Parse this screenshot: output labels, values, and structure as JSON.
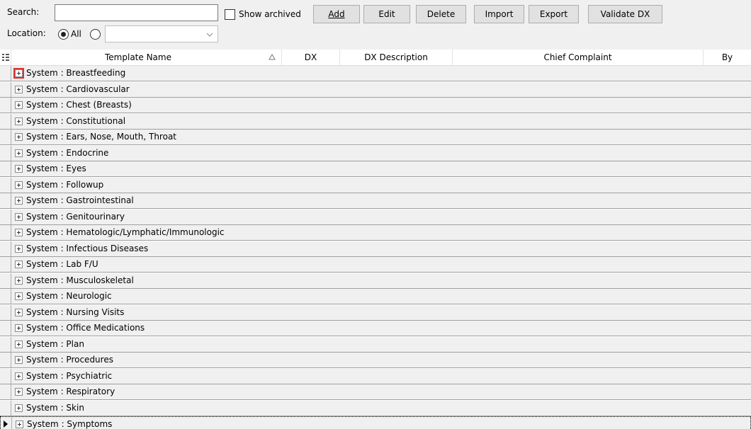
{
  "toolbar": {
    "search_label": "Search:",
    "search_value": "",
    "show_archived_label": "Show archived",
    "buttons": {
      "add": "Add",
      "edit": "Edit",
      "delete": "Delete",
      "import": "Import",
      "export": "Export",
      "validate": "Validate DX"
    },
    "location_label": "Location:",
    "location_all_label": "All",
    "location_select_value": ""
  },
  "grid": {
    "columns": {
      "template_name": "Template Name",
      "dx": "DX",
      "dx_description": "DX Description",
      "chief_complaint": "Chief Complaint",
      "by": "By"
    },
    "rows": [
      "System : Breastfeeding",
      "System : Cardiovascular",
      "System : Chest (Breasts)",
      "System : Constitutional",
      "System : Ears, Nose, Mouth, Throat",
      "System : Endocrine",
      "System : Eyes",
      "System : Followup",
      "System : Gastrointestinal",
      "System : Genitourinary",
      "System : Hematologic/Lymphatic/Immunologic",
      "System : Infectious Diseases",
      "System : Lab F/U",
      "System : Musculoskeletal",
      "System : Neurologic",
      "System : Nursing Visits",
      "System : Office Medications",
      "System : Plan",
      "System : Procedures",
      "System : Psychiatric",
      "System : Respiratory",
      "System : Skin",
      "System : Symptoms"
    ]
  }
}
